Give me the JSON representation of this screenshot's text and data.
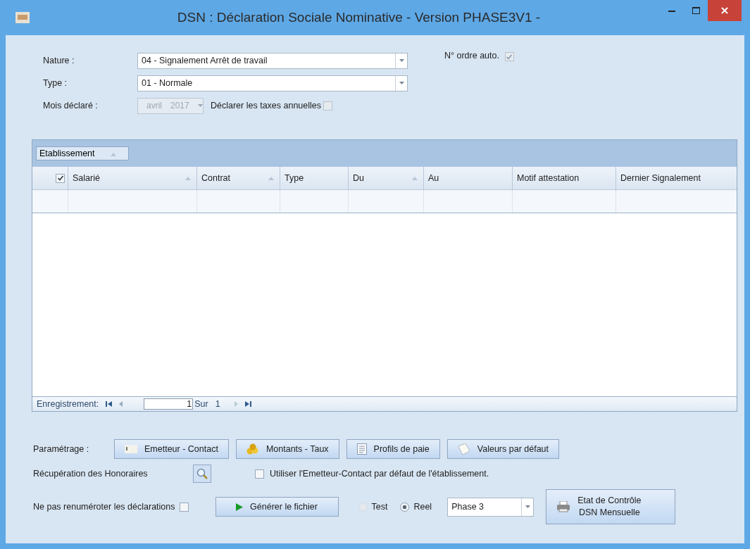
{
  "window": {
    "title": "DSN : Déclaration Sociale Nominative - Version PHASE3V1 -"
  },
  "form": {
    "nature": {
      "label": "Nature :",
      "value": "04 - Signalement Arrêt de travail"
    },
    "type": {
      "label": "Type :",
      "value": "01 - Normale"
    },
    "auto_order": {
      "label": "N° ordre auto.",
      "checked": true
    },
    "month": {
      "label": "Mois déclaré :",
      "month": "avril",
      "year": "2017",
      "disabled": true
    },
    "annual_taxes": {
      "label": "Déclarer les taxes annuelles",
      "checked": false
    }
  },
  "grid": {
    "group_by": {
      "label": "Etablissement",
      "sortable": true
    },
    "select_all": {
      "checked": true
    },
    "columns": [
      {
        "label": "Salarié",
        "sortable": true
      },
      {
        "label": "Contrat",
        "sortable": true
      },
      {
        "label": "Type",
        "sortable": false
      },
      {
        "label": "Du",
        "sortable": true
      },
      {
        "label": "Au",
        "sortable": false
      },
      {
        "label": "Motif attestation",
        "sortable": false
      },
      {
        "label": "Dernier Signalement",
        "sortable": false
      }
    ],
    "pager": {
      "label": "Enregistrement:",
      "current": "1",
      "of": "Sur",
      "total": "1"
    }
  },
  "settings": {
    "label": "Paramétrage :",
    "buttons": [
      {
        "label": "Emetteur - Contact",
        "kind": "contact"
      },
      {
        "label": "Montants - Taux",
        "kind": "amounts"
      },
      {
        "label": "Profils de paie",
        "kind": "profiles"
      },
      {
        "label": "Valeurs par défaut",
        "kind": "defaults"
      }
    ]
  },
  "fees": {
    "label": "Récupération des Honoraires"
  },
  "use_default_contact": {
    "label": "Utiliser l'Emetteur-Contact par défaut de l'établissement.",
    "checked": false
  },
  "no_renumber": {
    "label": "Ne pas renuméroter les déclarations",
    "checked": false
  },
  "generate": {
    "label": "Générer le fichier"
  },
  "modes": [
    {
      "label": "Test",
      "selected": false,
      "disabled": true
    },
    {
      "label": "Reel",
      "selected": true,
      "disabled": false
    }
  ],
  "phase": {
    "value": "Phase 3"
  },
  "report": {
    "lines": [
      "Etat de Contrôle",
      "DSN Mensuelle"
    ]
  }
}
